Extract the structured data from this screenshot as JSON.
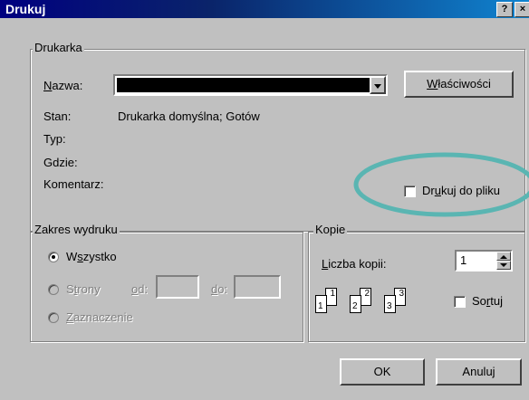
{
  "dialog": {
    "title": "Drukuj",
    "help_button": "?",
    "close_button": "×"
  },
  "printer": {
    "group_label": "Drukarka",
    "name_label_ul": "N",
    "name_label_rest": "azwa:",
    "name_value": "",
    "properties_ul": "W",
    "properties_rest": "łaściwości",
    "status_label": "Stan:",
    "status_value": "Drukarka domyślna; Gotów",
    "type_label": "Typ:",
    "where_label": "Gdzie:",
    "comment_label": "Komentarz:",
    "print_to_file_pre": "Dr",
    "print_to_file_ul": "u",
    "print_to_file_post": "kuj do pliku",
    "print_to_file_checked": false
  },
  "range": {
    "group_label": "Zakres wydruku",
    "all_pre": "W",
    "all_ul": "s",
    "all_post": "zystko",
    "pages_pre": "S",
    "pages_ul": "t",
    "pages_post": "rony",
    "from_ul": "o",
    "from_post": "d:",
    "from_value": "",
    "to_ul": "d",
    "to_post": "o:",
    "to_value": "",
    "selection_ul": "Z",
    "selection_post": "aznaczenie",
    "selected": "all"
  },
  "copies": {
    "group_label": "Kopie",
    "count_label_ul": "L",
    "count_label_rest": "iczba kopii:",
    "count_value": "1",
    "collate_pre": "So",
    "collate_ul": "r",
    "collate_post": "tuj",
    "collate_checked": false,
    "pages": [
      "1",
      "1",
      "2",
      "2",
      "3",
      "3"
    ]
  },
  "buttons": {
    "ok": "OK",
    "cancel": "Anuluj"
  },
  "colors": {
    "highlight_ellipse": "#5ab5b2"
  }
}
